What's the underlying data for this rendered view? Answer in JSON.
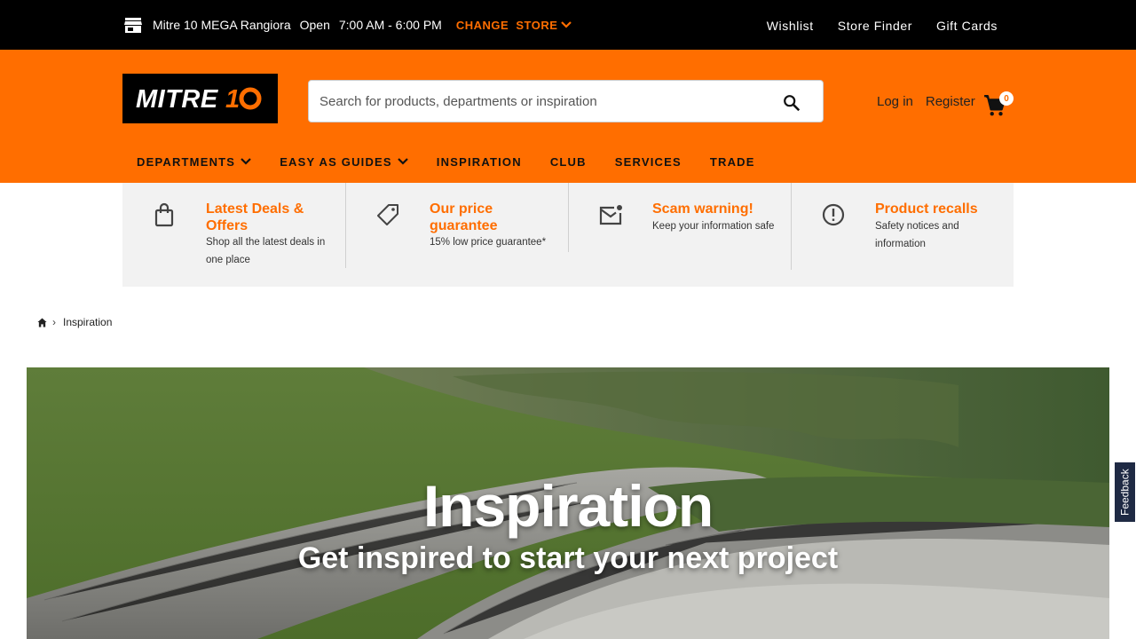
{
  "topbar": {
    "store_name": "Mitre 10 MEGA Rangiora",
    "status": "Open",
    "hours": "7:00 AM - 6:00 PM",
    "change_store": "CHANGE  STORE",
    "links": [
      "Wishlist",
      "Store Finder",
      "Gift Cards"
    ]
  },
  "header": {
    "logo_text": "MITRE 10",
    "search_placeholder": "Search for products, departments or inspiration",
    "login": "Log in",
    "register": "Register",
    "cart_count": "0",
    "nav": [
      {
        "label": "DEPARTMENTS",
        "dropdown": true
      },
      {
        "label": "EASY AS GUIDES",
        "dropdown": true
      },
      {
        "label": "INSPIRATION",
        "dropdown": false
      },
      {
        "label": "CLUB",
        "dropdown": false
      },
      {
        "label": "SERVICES",
        "dropdown": false
      },
      {
        "label": "TRADE",
        "dropdown": false
      }
    ]
  },
  "info_cards": [
    {
      "icon": "shopping-bag-icon",
      "title": "Latest Deals & Offers",
      "desc": "Shop all the latest deals in one place"
    },
    {
      "icon": "price-tag-icon",
      "title": "Our price guarantee",
      "desc": "15% low price guarantee*"
    },
    {
      "icon": "mail-alert-icon",
      "title": "Scam warning!",
      "desc": "Keep your information safe"
    },
    {
      "icon": "alert-circle-icon",
      "title": "Product recalls",
      "desc": "Safety notices and information"
    }
  ],
  "breadcrumb": {
    "current": "Inspiration"
  },
  "hero": {
    "title": "Inspiration",
    "subtitle": "Get inspired to start your next project"
  },
  "feedback": "Feedback",
  "colors": {
    "brand": "#ff6e00",
    "topbar": "#000000",
    "strip": "#f2f2f2"
  }
}
